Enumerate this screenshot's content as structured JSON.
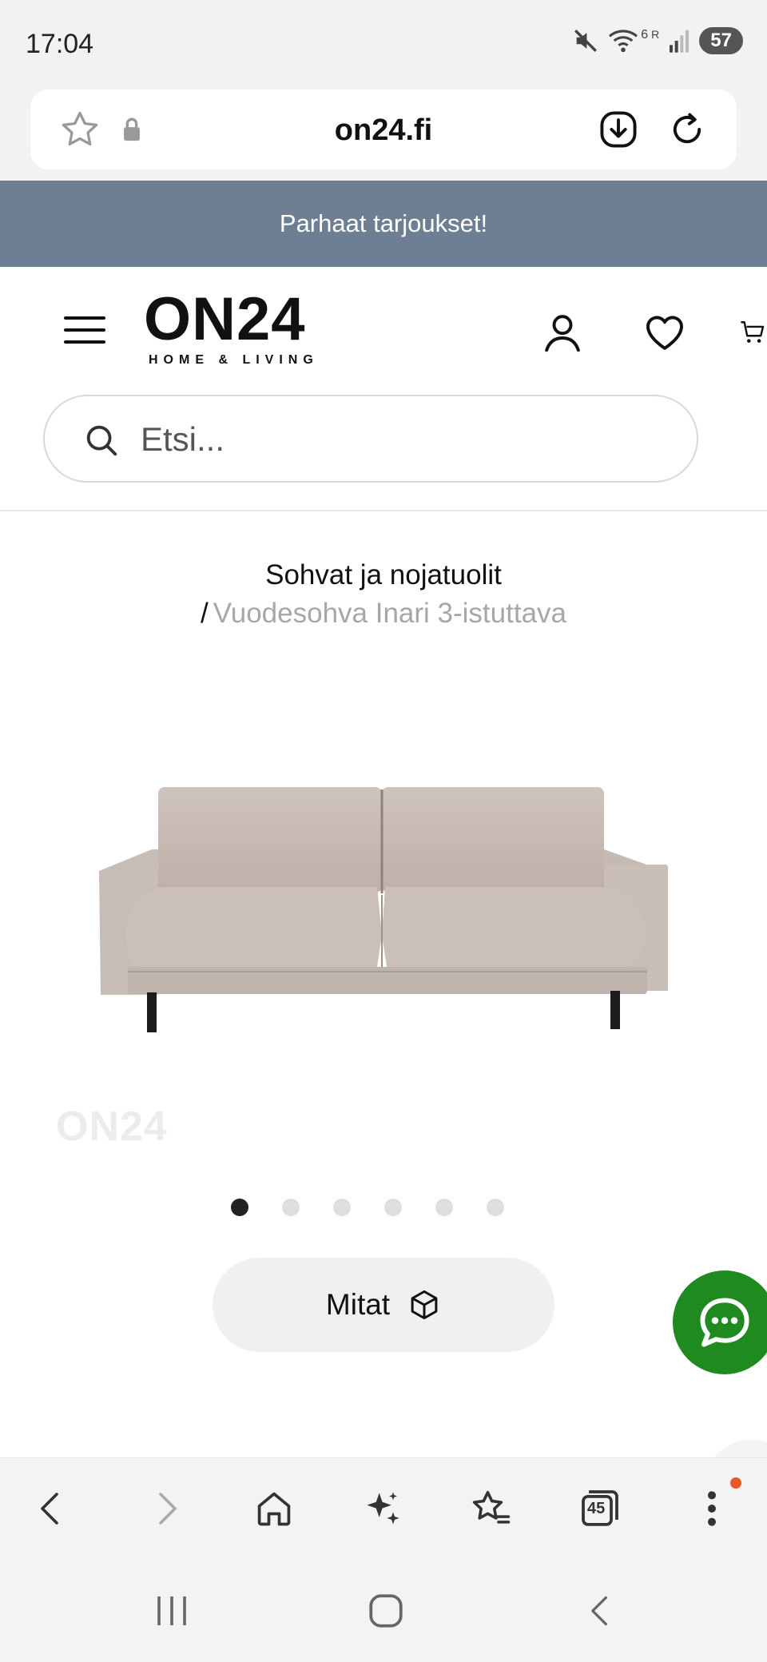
{
  "status_bar": {
    "time": "17:04",
    "battery": "57",
    "network_labels": [
      "6",
      "R"
    ]
  },
  "browser": {
    "url": "on24.fi"
  },
  "promo_banner": {
    "text": "Parhaat tarjoukset!"
  },
  "header": {
    "logo_main": "ON24",
    "logo_sub": "HOME & LIVING",
    "search_placeholder": "Etsi..."
  },
  "breadcrumb": {
    "category": "Sohvat ja nojatuolit",
    "separator": "/",
    "current": "Vuodesohva Inari 3-istuttava"
  },
  "product": {
    "watermark": "ON24",
    "carousel": {
      "count": 6,
      "active_index": 0
    },
    "dimensions_button": "Mitat"
  },
  "bottom_bar": {
    "tabs_count": "45"
  },
  "colors": {
    "promo_bg": "#6e7f93",
    "chat_green": "#1f8a1f",
    "notification_dot": "#e8592a",
    "breadcrumb_current": "#a7a7a7"
  },
  "icons": [
    "star-icon",
    "lock-icon",
    "download-icon",
    "reload-icon",
    "menu-icon",
    "user-icon",
    "heart-icon",
    "cart-icon",
    "search-icon",
    "cube-icon",
    "chat-icon",
    "back-icon",
    "forward-icon",
    "home-icon",
    "sparkle-icon",
    "bookmarks-icon",
    "tabs-icon",
    "more-icon"
  ]
}
